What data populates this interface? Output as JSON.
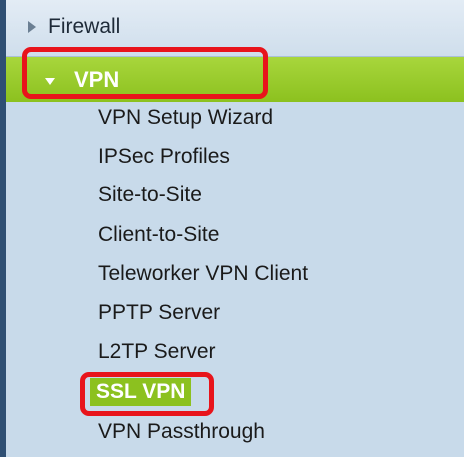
{
  "colors": {
    "accent_green": "#8cc11f",
    "highlight_red": "#e8141b",
    "panel_bg": "#c8daea"
  },
  "nav": {
    "firewall": {
      "label": "Firewall",
      "icon": "chevron-right-icon"
    },
    "vpn": {
      "label": "VPN",
      "icon": "chevron-down-icon",
      "expanded": true,
      "highlighted": true
    },
    "vpn_items": [
      {
        "label": "VPN Setup Wizard"
      },
      {
        "label": "IPSec Profiles"
      },
      {
        "label": "Site-to-Site"
      },
      {
        "label": "Client-to-Site"
      },
      {
        "label": "Teleworker VPN Client"
      },
      {
        "label": "PPTP Server"
      },
      {
        "label": "L2TP Server"
      },
      {
        "label": "SSL VPN",
        "selected": true,
        "highlighted": true
      },
      {
        "label": "VPN Passthrough"
      }
    ]
  }
}
